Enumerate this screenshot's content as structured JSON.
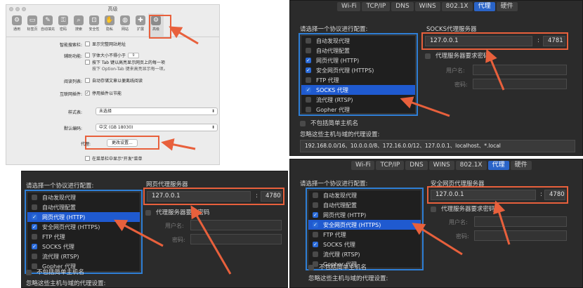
{
  "panel1": {
    "window_title": "高级",
    "toolbar": [
      {
        "label": "通用",
        "icon": "switch-icon"
      },
      {
        "label": "标签页",
        "icon": "tabs-icon"
      },
      {
        "label": "自动填充",
        "icon": "pen-icon"
      },
      {
        "label": "密码",
        "icon": "key-icon"
      },
      {
        "label": "搜索",
        "icon": "search-icon"
      },
      {
        "label": "安全性",
        "icon": "lock-icon"
      },
      {
        "label": "隐私",
        "icon": "hand-icon"
      },
      {
        "label": "网站",
        "icon": "globe-icon"
      },
      {
        "label": "扩展",
        "icon": "puzzle-icon"
      },
      {
        "label": "高级",
        "icon": "gear-icon"
      }
    ],
    "smart_search_label": "智能搜索栏:",
    "smart_search_opt": "显示完整网站地址",
    "accessibility_label": "辅助功能:",
    "acc_opt1_pre": "字体大小不得小于",
    "acc_opt1_val": "9",
    "acc_opt2": "按下 Tab 键以高亮显示网页上的每一项",
    "acc_opt2_sub": "按下 Option-Tab 键来高亮显示每一项。",
    "reading_label": "阅读列表:",
    "reading_opt": "自动存储文章以便离线阅读",
    "plugins_label": "互联网插件:",
    "plugins_opt": "停用插件以节能",
    "stylesheet_label": "样式表:",
    "stylesheet_value": "未选择",
    "encoding_label": "默认编码:",
    "encoding_value": "中文 (GB 18030)",
    "proxy_label": "代理:",
    "proxy_button": "更改设置...",
    "develop_opt": "在菜单栏中显示\"开发\"菜单"
  },
  "panel2": {
    "tabs": [
      "Wi-Fi",
      "TCP/IP",
      "DNS",
      "WINS",
      "802.1X",
      "代理",
      "硬件"
    ],
    "active_tab": "代理",
    "select_protocol": "请选择一个协议进行配置:",
    "protocols": [
      {
        "label": "自动发现代理",
        "checked": false,
        "selected": false
      },
      {
        "label": "自动代理配置",
        "checked": false,
        "selected": false
      },
      {
        "label": "网页代理 (HTTP)",
        "checked": true,
        "selected": false
      },
      {
        "label": "安全网页代理 (HTTPS)",
        "checked": true,
        "selected": false
      },
      {
        "label": "FTP 代理",
        "checked": false,
        "selected": false
      },
      {
        "label": "SOCKS 代理",
        "checked": true,
        "selected": true
      },
      {
        "label": "流代理 (RTSP)",
        "checked": false,
        "selected": false
      },
      {
        "label": "Gopher 代理",
        "checked": false,
        "selected": false
      }
    ],
    "server_title": "SOCKS代理服务器",
    "server_ip": "127.0.0.1",
    "colon": ":",
    "server_port": "4781",
    "requires_password": "代理服务器要求密码",
    "username_label": "用户名:",
    "password_label": "密码:",
    "exclude_simple": "不包括简单主机名",
    "bypass_label": "忽略这些主机与域的代理设置:",
    "bypass_value": "192.168.0.0/16、10.0.0.0/8、172.16.0.0/12、127.0.0.1、localhost、*.local"
  },
  "panel3": {
    "select_protocol": "请选择一个协议进行配置:",
    "protocols": [
      {
        "label": "自动发现代理",
        "checked": false,
        "selected": false
      },
      {
        "label": "自动代理配置",
        "checked": false,
        "selected": false
      },
      {
        "label": "网页代理 (HTTP)",
        "checked": true,
        "selected": true
      },
      {
        "label": "安全网页代理 (HTTPS)",
        "checked": true,
        "selected": false
      },
      {
        "label": "FTP 代理",
        "checked": false,
        "selected": false
      },
      {
        "label": "SOCKS 代理",
        "checked": true,
        "selected": false
      },
      {
        "label": "流代理 (RTSP)",
        "checked": false,
        "selected": false
      },
      {
        "label": "Gopher 代理",
        "checked": false,
        "selected": false
      }
    ],
    "server_title": "网页代理服务器",
    "server_ip": "127.0.0.1",
    "colon": ":",
    "server_port": "4780",
    "requires_password": "代理服务器要求密码",
    "username_label": "用户名:",
    "password_label": "密码:",
    "exclude_simple": "不包括简单主机名",
    "bypass_label": "忽略这些主机与域的代理设置:"
  },
  "panel4": {
    "tabs": [
      "Wi-Fi",
      "TCP/IP",
      "DNS",
      "WINS",
      "802.1X",
      "代理",
      "硬件"
    ],
    "active_tab": "代理",
    "select_protocol": "请选择一个协议进行配置:",
    "protocols": [
      {
        "label": "自动发现代理",
        "checked": false,
        "selected": false
      },
      {
        "label": "自动代理配置",
        "checked": false,
        "selected": false
      },
      {
        "label": "网页代理 (HTTP)",
        "checked": true,
        "selected": false
      },
      {
        "label": "安全网页代理 (HTTPS)",
        "checked": true,
        "selected": true
      },
      {
        "label": "FTP 代理",
        "checked": false,
        "selected": false
      },
      {
        "label": "SOCKS 代理",
        "checked": true,
        "selected": false
      },
      {
        "label": "流代理 (RTSP)",
        "checked": false,
        "selected": false
      },
      {
        "label": "Gopher 代理",
        "checked": false,
        "selected": false
      }
    ],
    "server_title": "安全网页代理服务器",
    "server_ip": "127.0.0.1",
    "colon": ":",
    "server_port": "4780",
    "requires_password": "代理服务器要求密码",
    "username_label": "用户名:",
    "password_label": "密码:",
    "exclude_simple": "不包括简单主机名",
    "bypass_label": "忽略这些主机与域的代理设置:"
  },
  "colors": {
    "annotation": "#e8603c",
    "selection": "#1f5ad0",
    "list_outline": "#2f7fd6"
  }
}
